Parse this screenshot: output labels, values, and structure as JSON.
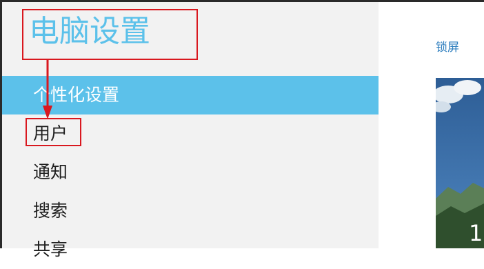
{
  "sidebar": {
    "title": "电脑设置",
    "items": [
      {
        "label": "个性化设置",
        "selected": true
      },
      {
        "label": "用户",
        "selected": false
      },
      {
        "label": "通知",
        "selected": false
      },
      {
        "label": "搜索",
        "selected": false
      },
      {
        "label": "共享",
        "selected": false
      }
    ]
  },
  "main": {
    "section_label": "锁屏",
    "preview_text": "1"
  },
  "colors": {
    "accent": "#5cc1ea",
    "annotation": "#d9181f",
    "sidebar_background": "#f2f2f2",
    "link": "#2f7fbf"
  },
  "annotations": [
    "red-box-title",
    "red-box-user-item",
    "red-arrow-title-to-user"
  ]
}
